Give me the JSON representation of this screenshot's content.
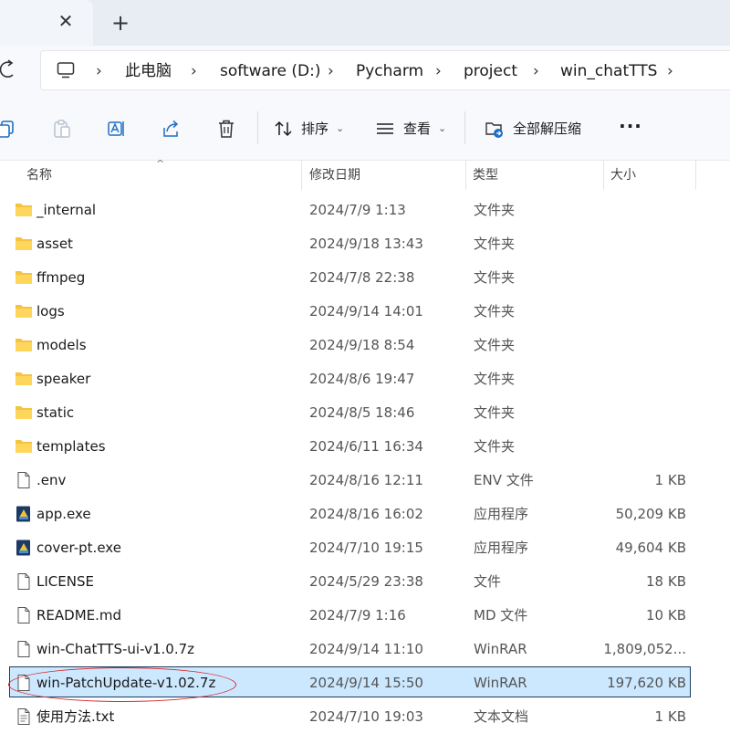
{
  "tabbar": {
    "close_glyph": "✕",
    "new_glyph": "+"
  },
  "breadcrumb": {
    "items": [
      "此电脑",
      "software (D:)",
      "Pycharm",
      "project",
      "win_chatTTS"
    ],
    "separator": "›"
  },
  "toolbar": {
    "sort_label": "排序",
    "view_label": "查看",
    "extract_label": "全部解压缩",
    "more_glyph": "···",
    "caret": "⌄"
  },
  "columns": {
    "name": "名称",
    "date": "修改日期",
    "type": "类型",
    "size": "大小",
    "sort_glyph": "^"
  },
  "files": [
    {
      "name": "_internal",
      "date": "2024/7/9 1:13",
      "type": "文件夹",
      "size": "",
      "icon": "folder-icon"
    },
    {
      "name": "asset",
      "date": "2024/9/18 13:43",
      "type": "文件夹",
      "size": "",
      "icon": "folder-icon"
    },
    {
      "name": "ffmpeg",
      "date": "2024/7/8 22:38",
      "type": "文件夹",
      "size": "",
      "icon": "folder-icon"
    },
    {
      "name": "logs",
      "date": "2024/9/14 14:01",
      "type": "文件夹",
      "size": "",
      "icon": "folder-icon"
    },
    {
      "name": "models",
      "date": "2024/9/18 8:54",
      "type": "文件夹",
      "size": "",
      "icon": "folder-icon"
    },
    {
      "name": "speaker",
      "date": "2024/8/6 19:47",
      "type": "文件夹",
      "size": "",
      "icon": "folder-icon"
    },
    {
      "name": "static",
      "date": "2024/8/5 18:46",
      "type": "文件夹",
      "size": "",
      "icon": "folder-icon"
    },
    {
      "name": "templates",
      "date": "2024/6/11 16:34",
      "type": "文件夹",
      "size": "",
      "icon": "folder-icon"
    },
    {
      "name": ".env",
      "date": "2024/8/16 12:11",
      "type": "ENV 文件",
      "size": "1 KB",
      "icon": "file-icon"
    },
    {
      "name": "app.exe",
      "date": "2024/8/16 16:02",
      "type": "应用程序",
      "size": "50,209 KB",
      "icon": "exe-icon"
    },
    {
      "name": "cover-pt.exe",
      "date": "2024/7/10 19:15",
      "type": "应用程序",
      "size": "49,604 KB",
      "icon": "exe-icon"
    },
    {
      "name": "LICENSE",
      "date": "2024/5/29 23:38",
      "type": "文件",
      "size": "18 KB",
      "icon": "file-icon"
    },
    {
      "name": "README.md",
      "date": "2024/7/9 1:16",
      "type": "MD 文件",
      "size": "10 KB",
      "icon": "file-icon"
    },
    {
      "name": "win-ChatTTS-ui-v1.0.7z",
      "date": "2024/9/14 11:10",
      "type": "WinRAR",
      "size": "1,809,052...",
      "icon": "file-icon"
    },
    {
      "name": "win-PatchUpdate-v1.02.7z",
      "date": "2024/9/14 15:50",
      "type": "WinRAR",
      "size": "197,620 KB",
      "icon": "file-icon",
      "selected": true
    },
    {
      "name": "使用方法.txt",
      "date": "2024/7/10 19:03",
      "type": "文本文档",
      "size": "1 KB",
      "icon": "text-file-icon"
    }
  ],
  "colors": {
    "selection": "#cce8ff",
    "selection_border": "#1e3a5c",
    "annotation": "#d42a2a",
    "folder": "#f5c342"
  }
}
